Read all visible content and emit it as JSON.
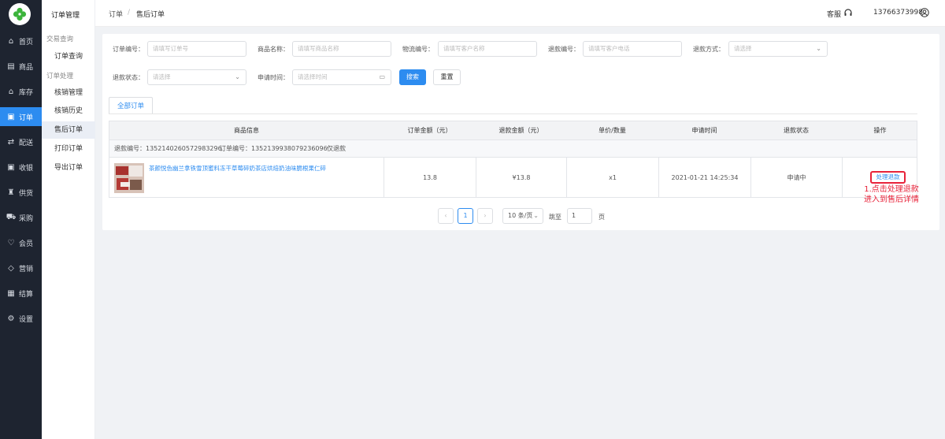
{
  "rail": {
    "items": [
      {
        "icon": "⌂",
        "label": "首页"
      },
      {
        "icon": "▤",
        "label": "商品"
      },
      {
        "icon": "⌂",
        "label": "库存"
      },
      {
        "icon": "▣",
        "label": "订单"
      },
      {
        "icon": "⇄",
        "label": "配送"
      },
      {
        "icon": "▣",
        "label": "收银"
      },
      {
        "icon": "♜",
        "label": "供货"
      },
      {
        "icon": "⛟",
        "label": "采购"
      },
      {
        "icon": "♡",
        "label": "会员"
      },
      {
        "icon": "◇",
        "label": "营销"
      },
      {
        "icon": "▦",
        "label": "结算"
      },
      {
        "icon": "⚙",
        "label": "设置"
      }
    ],
    "active": 3
  },
  "submenu": {
    "title": "订单管理",
    "group1": "交易查询",
    "group2": "订单处理",
    "items": [
      "订单查询",
      "核销管理",
      "核销历史",
      "售后订单",
      "打印订单",
      "导出订单"
    ]
  },
  "breadcrumb": {
    "root": "订单",
    "sep": "/",
    "current": "售后订单"
  },
  "header": {
    "service": "客服",
    "phone": "13766373998"
  },
  "filters": {
    "order_no": {
      "label": "订单编号：",
      "placeholder": "请填写订单号"
    },
    "product_name": {
      "label": "商品名称：",
      "placeholder": "请填写商品名称"
    },
    "logistics_no": {
      "label": "物流编号：",
      "placeholder": "请填写客户名称"
    },
    "refund_no": {
      "label": "退款编号：",
      "placeholder": "请填写客户电话"
    },
    "refund_method": {
      "label": "退款方式：",
      "placeholder": "请选择"
    },
    "refund_status": {
      "label": "退款状态：",
      "placeholder": "请选择"
    },
    "apply_time": {
      "label": "申请时间：",
      "placeholder": "请选择时间"
    },
    "search_label": "搜索",
    "reset_label": "重置"
  },
  "tab_label": "全部订单",
  "table": {
    "headers": [
      "商品信息",
      "订单金额（元）",
      "退款金额（元）",
      "单价/数量",
      "申请时间",
      "退款状态",
      "操作"
    ],
    "info": {
      "refund_no": "退款编号：1352140260572983296",
      "order_no": "订单编号：1352139938079236096",
      "type": "仅退款"
    },
    "row": {
      "product": "茶颜悦色幽兰拿铁雪顶蜜料冻干草莓碎奶茶店烘焙奶油味脆根果仁碎",
      "order_amount": "13.8",
      "refund_amount": "¥13.8",
      "qty": "x1",
      "time": "2021-01-21 14:25:34",
      "status": "申请中",
      "action": "处理退款"
    }
  },
  "pagination": {
    "prev": "‹",
    "page": "1",
    "next": "›",
    "per_page": "10 条/页",
    "goto_label": "跳至",
    "goto_value": "1",
    "page_unit": "页"
  },
  "annotation": {
    "line1": "1.点击处理退款",
    "line2": "进入到售后详情"
  },
  "colors": {
    "accent": "#2d8cf0",
    "sidebar": "#1e2430",
    "annotation": "#e8233a"
  }
}
